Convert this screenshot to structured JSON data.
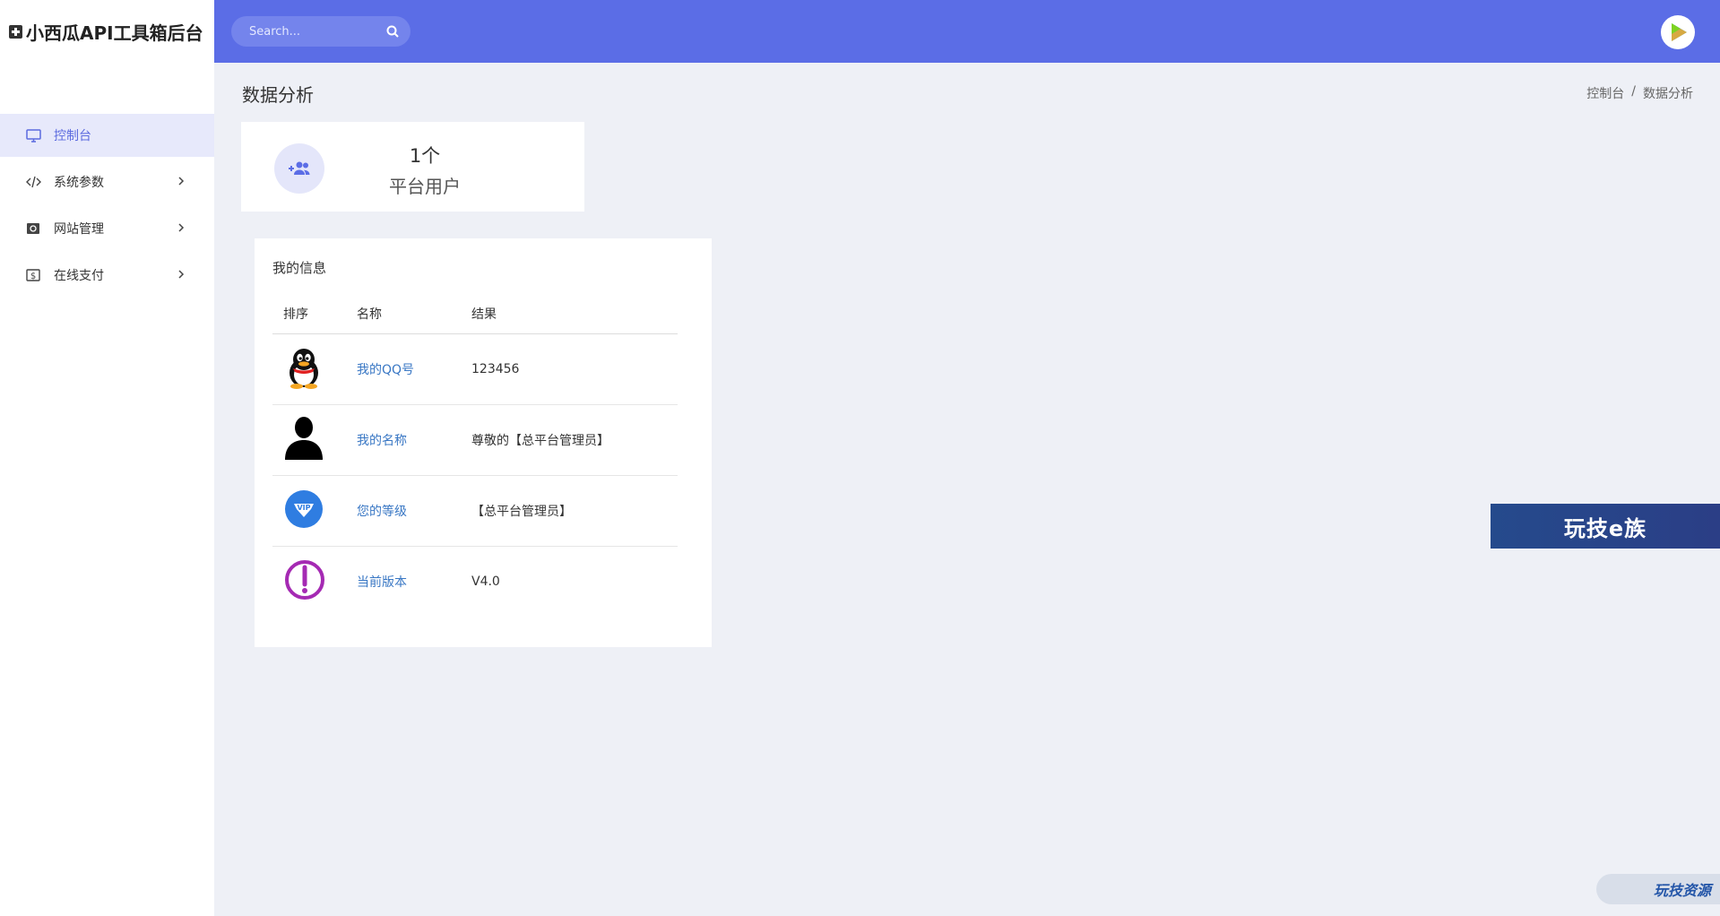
{
  "brand": {
    "title": "小西瓜API工具箱后台"
  },
  "sidebar": {
    "items": [
      {
        "label": "控制台",
        "icon": "monitor-icon",
        "active": true
      },
      {
        "label": "系统参数",
        "icon": "code-icon",
        "active": false
      },
      {
        "label": "网站管理",
        "icon": "web-icon",
        "active": false
      },
      {
        "label": "在线支付",
        "icon": "dollar-icon",
        "active": false
      }
    ]
  },
  "header": {
    "search_placeholder": "Search...",
    "accent_color": "#5b6de6"
  },
  "page": {
    "title": "数据分析",
    "breadcrumb": [
      "控制台",
      "/",
      "数据分析"
    ]
  },
  "stat": {
    "value": "1个",
    "label": "平台用户"
  },
  "info": {
    "title": "我的信息",
    "headers": [
      "排序",
      "名称",
      "结果"
    ],
    "rows": [
      {
        "icon": "qq-penguin-icon",
        "name": "我的QQ号",
        "value": "123456"
      },
      {
        "icon": "user-silhouette-icon",
        "name": "我的名称",
        "value": "尊敬的【总平台管理员】"
      },
      {
        "icon": "vip-badge-icon",
        "name": "您的等级",
        "value": "【总平台管理员】"
      },
      {
        "icon": "exclamation-icon",
        "name": "当前版本",
        "value": "V4.0"
      }
    ]
  },
  "ads": {
    "banner_text": "玩技e族",
    "badge_text": "玩技资源"
  }
}
